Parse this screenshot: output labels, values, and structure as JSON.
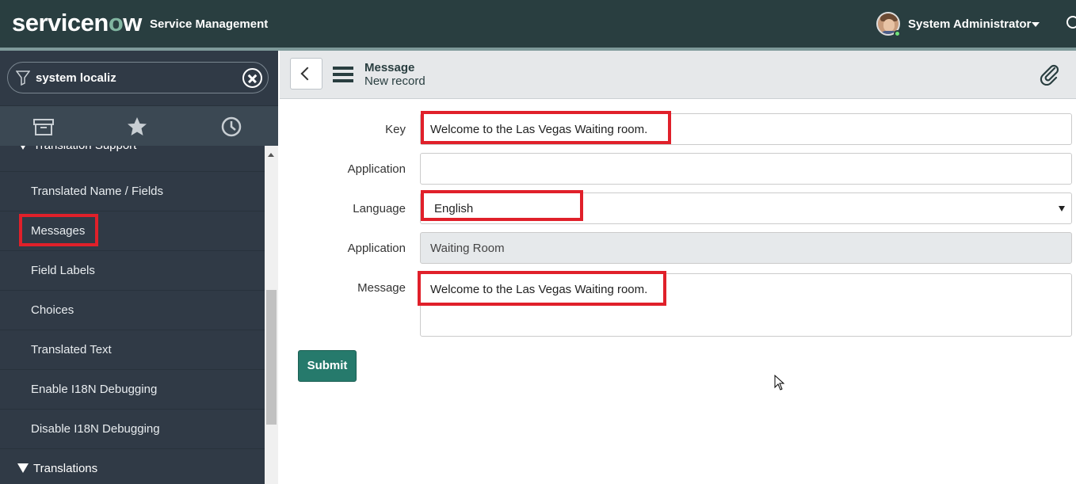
{
  "banner": {
    "logo_part1": "servicen",
    "logo_accent": "o",
    "logo_part2": "w",
    "app_name": "Service Management",
    "user_name": "System Administrator"
  },
  "navigator": {
    "filter_value": "system localiz",
    "tab_icons": [
      "archive-icon",
      "star-icon",
      "history-clock-icon"
    ],
    "section_partial": "Translation Support",
    "items": [
      {
        "label": "Translated Name / Fields"
      },
      {
        "label": "Messages",
        "highlighted": true
      },
      {
        "label": "Field Labels"
      },
      {
        "label": "Choices"
      },
      {
        "label": "Translated Text"
      },
      {
        "label": "Enable I18N Debugging"
      },
      {
        "label": "Disable I18N Debugging"
      }
    ],
    "section_next": "Translations"
  },
  "form": {
    "title": "Message",
    "subtitle": "New record",
    "fields": {
      "key": {
        "label": "Key",
        "value": "Welcome to the Las Vegas Waiting room."
      },
      "application_input": {
        "label": "Application",
        "value": ""
      },
      "language": {
        "label": "Language",
        "value": "English"
      },
      "application_readonly": {
        "label": "Application",
        "value": "Waiting Room"
      },
      "message": {
        "label": "Message",
        "value": "Welcome to the Las Vegas Waiting room."
      }
    },
    "submit_label": "Submit"
  },
  "colors": {
    "banner": "#293e40",
    "sidebar": "#303a46",
    "highlight": "#e0202a",
    "submit": "#267a6c"
  }
}
